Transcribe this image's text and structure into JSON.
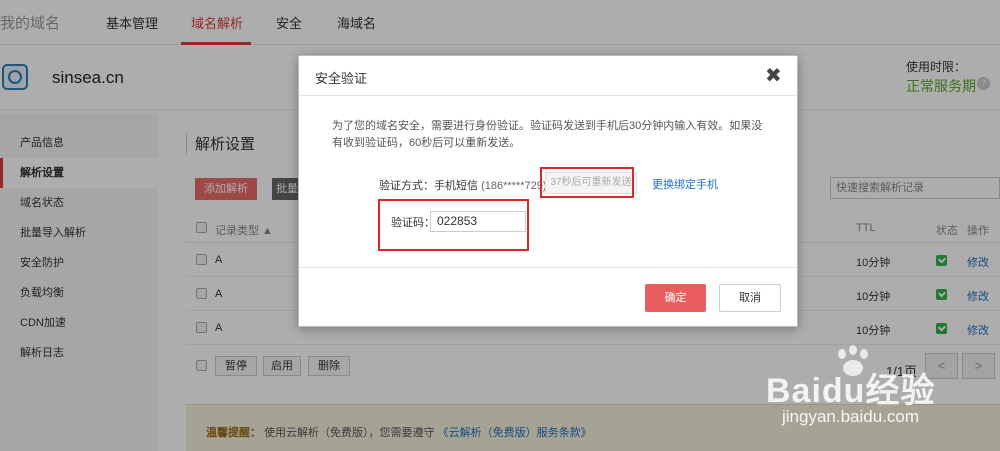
{
  "nav": {
    "brand": "我的域名",
    "items": [
      "基本管理",
      "域名解析",
      "安全",
      "海域名"
    ]
  },
  "domain": {
    "name": "sinsea.cn",
    "term_label": "使用时限：",
    "status": "正常服务期",
    "help": "?"
  },
  "sidebar": {
    "items": [
      "产品信息",
      "解析设置",
      "域名状态",
      "批量导入解析",
      "安全防护",
      "负载均衡",
      "CDN加速",
      "解析日志"
    ]
  },
  "main": {
    "title": "解析设置",
    "add_button": "添加解析",
    "batch_button": "批量",
    "search_placeholder": "快速搜索解析记录",
    "headers": {
      "type": "记录类型 ▲",
      "ttl": "TTL",
      "status": "状态",
      "action": "操作"
    },
    "rows": [
      {
        "type": "A",
        "ttl": "10分钟",
        "action": "修改"
      },
      {
        "type": "A",
        "ttl": "10分钟",
        "action": "修改"
      },
      {
        "type": "A",
        "ttl": "10分钟",
        "action": "修改"
      }
    ],
    "footer": {
      "pause": "暂停",
      "enable": "启用",
      "delete": "删除",
      "page_info": "1/1页",
      "prev": "<",
      "next": ">"
    },
    "notice": {
      "label": "温馨提醒：",
      "text": "使用云解析（免费版），您需要遵守",
      "link": "《云解析（免费版）服务条款》"
    }
  },
  "dialog": {
    "title": "安全验证",
    "close": "✖",
    "desc": "为了您的域名安全，需要进行身份验证。验证码发送到手机后30分钟内输入有效。如果没有收到验证码，60秒后可以重新发送。",
    "method_label": "验证方式：手机短信",
    "phone": "(186*****729)",
    "resend": "37秒后可重新发送",
    "change_phone": "更换绑定手机",
    "code_label": "验证码：",
    "code_value": "022853",
    "confirm": "确定",
    "cancel": "取消"
  },
  "watermark": {
    "main": "Baidu经验",
    "sub": "jingyan.baidu.com"
  }
}
